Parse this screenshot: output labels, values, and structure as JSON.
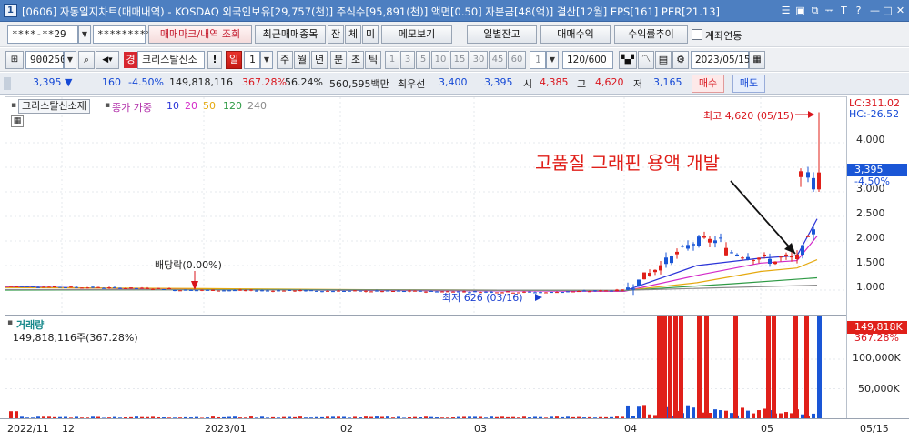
{
  "titlebar": {
    "number": "1",
    "text": "[0606] 자동일지차트(매매내역) - KOSDAQ 외국인보유[29,757(천)] 주식수[95,891(천)] 액면[0.50] 자본금[48(억)] 결산[12월] EPS[161] PER[21.13]",
    "buttons": [
      "☰",
      "▣",
      "⧉",
      "ᅲ",
      "T",
      "?",
      "|",
      "—",
      "□",
      "✕"
    ]
  },
  "row1": {
    "account_value": "****-**29",
    "password_value": "*********",
    "buttons": [
      "매매마크/내역 조회",
      "최근매매종목",
      "잔",
      "체",
      "미",
      "메모보기",
      "일별잔고",
      "매매수익",
      "수익률추이"
    ],
    "checkbox_label": "계좌연동"
  },
  "row2": {
    "code": "900250",
    "badge": "경",
    "stock_name": "크리스탈신소",
    "exclaim": "!",
    "period_active": "일",
    "period_count": "1",
    "periods": [
      "주",
      "월",
      "년",
      "분",
      "초",
      "틱"
    ],
    "intervals": [
      "1",
      "3",
      "5",
      "10",
      "15",
      "30",
      "45",
      "60"
    ],
    "interval_sel": "1",
    "count": "120/600",
    "date": "2023/05/15"
  },
  "quote": {
    "price": "3,395",
    "dir": "▼",
    "change": "160",
    "pct": "-4.50%",
    "volume": "149,818,116",
    "vol_ratio": "367.28%",
    "ratio2": "56.24%",
    "amount": "560,595백만",
    "pref_label": "최우선",
    "ask": "3,400",
    "bid": "3,395",
    "open_label": "시",
    "open": "4,385",
    "high_label": "고",
    "high": "4,620",
    "low_label": "저",
    "low": "3,165",
    "buy": "매수",
    "sell": "매도"
  },
  "chart_legend": {
    "name": "크리스탈신소재",
    "ma_label": "종가 가중",
    "ma_periods": [
      "10",
      "20",
      "50",
      "120",
      "240"
    ],
    "ma_colors": [
      "#2b34d8",
      "#d329c8",
      "#e5a90f",
      "#2e9a45",
      "#8a8a8a"
    ]
  },
  "price_axis": {
    "ticks": [
      "4,000",
      "3,500",
      "3,000",
      "2,500",
      "2,000",
      "1,500",
      "1,000"
    ],
    "lc": "LC:311.02",
    "hc": "HC:-26.52",
    "current": "3,395",
    "current_pct": "-4.50%"
  },
  "annotations": {
    "high": "최고 4,620 (05/15)",
    "low": "최저 626 (03/16)",
    "dividend": "배당락(0.00%)",
    "comment": "고품질 그래핀 용액 개발"
  },
  "volume": {
    "title": "거래량",
    "value": "149,818,116주(367.28%)",
    "axis_current": "149,818K",
    "axis_pct": "367.28%",
    "ticks": [
      "100,000K",
      "50,000K"
    ]
  },
  "xaxis": {
    "labels": [
      "2022/11",
      "12",
      "2023/01",
      "02",
      "03",
      "04",
      "05"
    ],
    "date_right": "05/15"
  },
  "colors": {
    "up": "#e0201a",
    "down": "#1a56d6",
    "accent": "#4d7fc1"
  },
  "chart_data": {
    "type": "candlestick",
    "title": "",
    "series": [
      {
        "name": "price",
        "ohlc_recent": [
          [
            3300,
            3480,
            3100,
            3420
          ],
          [
            3400,
            3510,
            3200,
            3290
          ],
          [
            3280,
            3400,
            3000,
            3050
          ],
          [
            3050,
            4620,
            3000,
            3395
          ]
        ]
      }
    ],
    "notable": {
      "high": 4620,
      "low": 626
    },
    "ylim": [
      500,
      4900
    ],
    "volume_recent_k": [
      12000,
      6000,
      20000,
      9000,
      30000,
      60000,
      52000,
      18000,
      25000,
      32000,
      45000,
      78000,
      149818
    ]
  }
}
